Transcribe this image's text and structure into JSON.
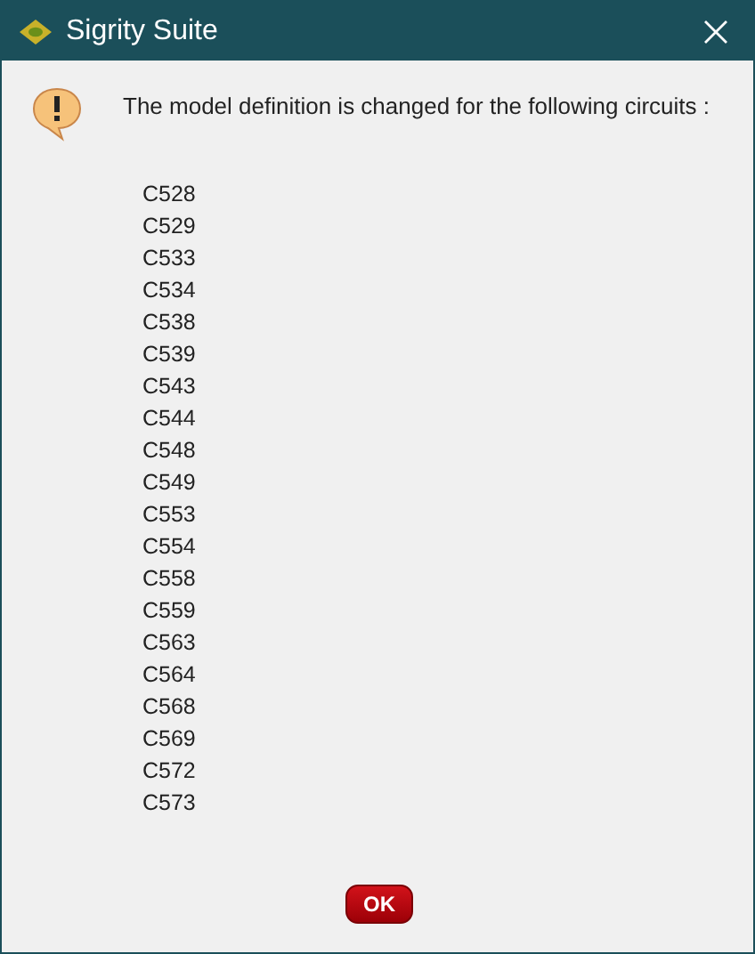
{
  "window": {
    "title": "Sigrity Suite"
  },
  "message": "The model definition is changed for the following circuits :",
  "circuits": [
    "C528",
    "C529",
    "C533",
    "C534",
    "C538",
    "C539",
    "C543",
    "C544",
    "C548",
    "C549",
    "C553",
    "C554",
    "C558",
    "C559",
    "C563",
    "C564",
    "C568",
    "C569",
    "C572",
    "C573"
  ],
  "buttons": [
    "OK"
  ]
}
